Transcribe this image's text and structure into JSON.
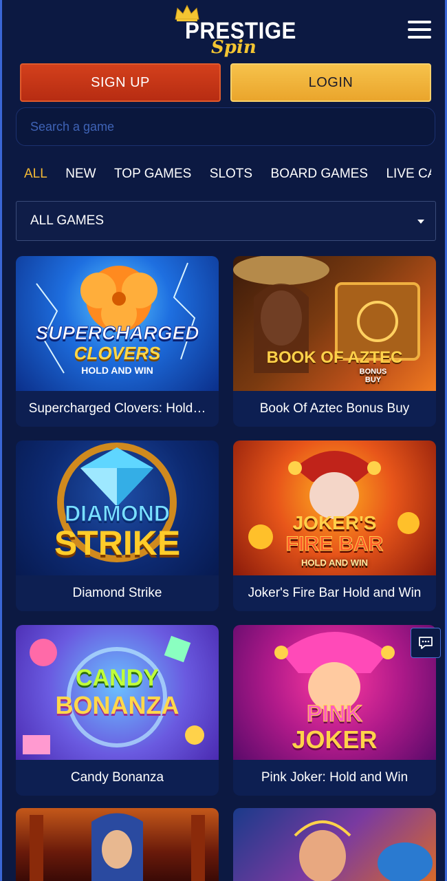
{
  "brand": {
    "name_line1": "PRESTIGE",
    "name_line2": "Spin",
    "accent": "#f3c532"
  },
  "header": {
    "menu_icon": "hamburger-icon"
  },
  "auth": {
    "signup_label": "SIGN UP",
    "login_label": "LOGIN"
  },
  "search": {
    "placeholder": "Search a game",
    "value": ""
  },
  "tabs": [
    {
      "label": "ALL",
      "active": true
    },
    {
      "label": "NEW",
      "active": false
    },
    {
      "label": "TOP GAMES",
      "active": false
    },
    {
      "label": "SLOTS",
      "active": false
    },
    {
      "label": "BOARD GAMES",
      "active": false
    },
    {
      "label": "LIVE CASINO",
      "active": false
    }
  ],
  "filter": {
    "selected": "ALL GAMES"
  },
  "games": [
    {
      "title": "Supercharged Clovers: Hold…",
      "art_line1": "SUPERCHARGED",
      "art_line2": "CLOVERS",
      "art_line3": "HOLD AND WIN"
    },
    {
      "title": "Book Of Aztec Bonus Buy",
      "art_line1": "BOOK OF AZTEC",
      "art_line2": "BONUS",
      "art_line3": "BUY"
    },
    {
      "title": "Diamond Strike",
      "art_line1": "DIAMOND",
      "art_line2": "STRIKE"
    },
    {
      "title": "Joker's Fire Bar Hold and Win",
      "art_line1": "JOKER'S",
      "art_line2": "FIRE BAR",
      "art_line3": "HOLD AND WIN"
    },
    {
      "title": "Candy Bonanza",
      "art_line1": "CANDY",
      "art_line2": "BONANZA"
    },
    {
      "title": "Pink Joker: Hold and Win",
      "art_line1": "PINK",
      "art_line2": "JOKER"
    }
  ],
  "chat": {
    "icon": "chat-bubble-icon"
  }
}
